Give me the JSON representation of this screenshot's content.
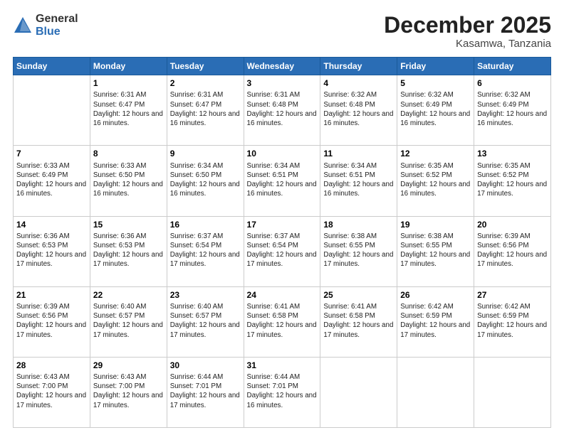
{
  "header": {
    "logo_general": "General",
    "logo_blue": "Blue",
    "month_title": "December 2025",
    "location": "Kasamwa, Tanzania"
  },
  "days_of_week": [
    "Sunday",
    "Monday",
    "Tuesday",
    "Wednesday",
    "Thursday",
    "Friday",
    "Saturday"
  ],
  "weeks": [
    [
      {
        "day": "",
        "sunrise": "",
        "sunset": "",
        "daylight": ""
      },
      {
        "day": "1",
        "sunrise": "Sunrise: 6:31 AM",
        "sunset": "Sunset: 6:47 PM",
        "daylight": "Daylight: 12 hours and 16 minutes."
      },
      {
        "day": "2",
        "sunrise": "Sunrise: 6:31 AM",
        "sunset": "Sunset: 6:47 PM",
        "daylight": "Daylight: 12 hours and 16 minutes."
      },
      {
        "day": "3",
        "sunrise": "Sunrise: 6:31 AM",
        "sunset": "Sunset: 6:48 PM",
        "daylight": "Daylight: 12 hours and 16 minutes."
      },
      {
        "day": "4",
        "sunrise": "Sunrise: 6:32 AM",
        "sunset": "Sunset: 6:48 PM",
        "daylight": "Daylight: 12 hours and 16 minutes."
      },
      {
        "day": "5",
        "sunrise": "Sunrise: 6:32 AM",
        "sunset": "Sunset: 6:49 PM",
        "daylight": "Daylight: 12 hours and 16 minutes."
      },
      {
        "day": "6",
        "sunrise": "Sunrise: 6:32 AM",
        "sunset": "Sunset: 6:49 PM",
        "daylight": "Daylight: 12 hours and 16 minutes."
      }
    ],
    [
      {
        "day": "7",
        "sunrise": "Sunrise: 6:33 AM",
        "sunset": "Sunset: 6:49 PM",
        "daylight": "Daylight: 12 hours and 16 minutes."
      },
      {
        "day": "8",
        "sunrise": "Sunrise: 6:33 AM",
        "sunset": "Sunset: 6:50 PM",
        "daylight": "Daylight: 12 hours and 16 minutes."
      },
      {
        "day": "9",
        "sunrise": "Sunrise: 6:34 AM",
        "sunset": "Sunset: 6:50 PM",
        "daylight": "Daylight: 12 hours and 16 minutes."
      },
      {
        "day": "10",
        "sunrise": "Sunrise: 6:34 AM",
        "sunset": "Sunset: 6:51 PM",
        "daylight": "Daylight: 12 hours and 16 minutes."
      },
      {
        "day": "11",
        "sunrise": "Sunrise: 6:34 AM",
        "sunset": "Sunset: 6:51 PM",
        "daylight": "Daylight: 12 hours and 16 minutes."
      },
      {
        "day": "12",
        "sunrise": "Sunrise: 6:35 AM",
        "sunset": "Sunset: 6:52 PM",
        "daylight": "Daylight: 12 hours and 16 minutes."
      },
      {
        "day": "13",
        "sunrise": "Sunrise: 6:35 AM",
        "sunset": "Sunset: 6:52 PM",
        "daylight": "Daylight: 12 hours and 17 minutes."
      }
    ],
    [
      {
        "day": "14",
        "sunrise": "Sunrise: 6:36 AM",
        "sunset": "Sunset: 6:53 PM",
        "daylight": "Daylight: 12 hours and 17 minutes."
      },
      {
        "day": "15",
        "sunrise": "Sunrise: 6:36 AM",
        "sunset": "Sunset: 6:53 PM",
        "daylight": "Daylight: 12 hours and 17 minutes."
      },
      {
        "day": "16",
        "sunrise": "Sunrise: 6:37 AM",
        "sunset": "Sunset: 6:54 PM",
        "daylight": "Daylight: 12 hours and 17 minutes."
      },
      {
        "day": "17",
        "sunrise": "Sunrise: 6:37 AM",
        "sunset": "Sunset: 6:54 PM",
        "daylight": "Daylight: 12 hours and 17 minutes."
      },
      {
        "day": "18",
        "sunrise": "Sunrise: 6:38 AM",
        "sunset": "Sunset: 6:55 PM",
        "daylight": "Daylight: 12 hours and 17 minutes."
      },
      {
        "day": "19",
        "sunrise": "Sunrise: 6:38 AM",
        "sunset": "Sunset: 6:55 PM",
        "daylight": "Daylight: 12 hours and 17 minutes."
      },
      {
        "day": "20",
        "sunrise": "Sunrise: 6:39 AM",
        "sunset": "Sunset: 6:56 PM",
        "daylight": "Daylight: 12 hours and 17 minutes."
      }
    ],
    [
      {
        "day": "21",
        "sunrise": "Sunrise: 6:39 AM",
        "sunset": "Sunset: 6:56 PM",
        "daylight": "Daylight: 12 hours and 17 minutes."
      },
      {
        "day": "22",
        "sunrise": "Sunrise: 6:40 AM",
        "sunset": "Sunset: 6:57 PM",
        "daylight": "Daylight: 12 hours and 17 minutes."
      },
      {
        "day": "23",
        "sunrise": "Sunrise: 6:40 AM",
        "sunset": "Sunset: 6:57 PM",
        "daylight": "Daylight: 12 hours and 17 minutes."
      },
      {
        "day": "24",
        "sunrise": "Sunrise: 6:41 AM",
        "sunset": "Sunset: 6:58 PM",
        "daylight": "Daylight: 12 hours and 17 minutes."
      },
      {
        "day": "25",
        "sunrise": "Sunrise: 6:41 AM",
        "sunset": "Sunset: 6:58 PM",
        "daylight": "Daylight: 12 hours and 17 minutes."
      },
      {
        "day": "26",
        "sunrise": "Sunrise: 6:42 AM",
        "sunset": "Sunset: 6:59 PM",
        "daylight": "Daylight: 12 hours and 17 minutes."
      },
      {
        "day": "27",
        "sunrise": "Sunrise: 6:42 AM",
        "sunset": "Sunset: 6:59 PM",
        "daylight": "Daylight: 12 hours and 17 minutes."
      }
    ],
    [
      {
        "day": "28",
        "sunrise": "Sunrise: 6:43 AM",
        "sunset": "Sunset: 7:00 PM",
        "daylight": "Daylight: 12 hours and 17 minutes."
      },
      {
        "day": "29",
        "sunrise": "Sunrise: 6:43 AM",
        "sunset": "Sunset: 7:00 PM",
        "daylight": "Daylight: 12 hours and 17 minutes."
      },
      {
        "day": "30",
        "sunrise": "Sunrise: 6:44 AM",
        "sunset": "Sunset: 7:01 PM",
        "daylight": "Daylight: 12 hours and 17 minutes."
      },
      {
        "day": "31",
        "sunrise": "Sunrise: 6:44 AM",
        "sunset": "Sunset: 7:01 PM",
        "daylight": "Daylight: 12 hours and 16 minutes."
      },
      {
        "day": "",
        "sunrise": "",
        "sunset": "",
        "daylight": ""
      },
      {
        "day": "",
        "sunrise": "",
        "sunset": "",
        "daylight": ""
      },
      {
        "day": "",
        "sunrise": "",
        "sunset": "",
        "daylight": ""
      }
    ]
  ]
}
